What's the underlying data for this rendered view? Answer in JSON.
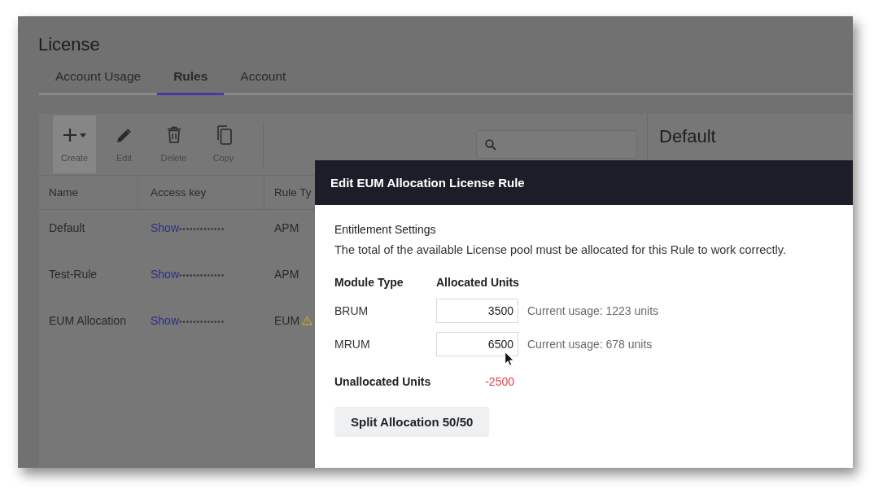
{
  "page": {
    "title": "License"
  },
  "tabs": [
    {
      "label": "Account Usage",
      "selected": false
    },
    {
      "label": "Rules",
      "selected": true
    },
    {
      "label": "Account",
      "selected": false
    }
  ],
  "toolbar": {
    "buttons": [
      {
        "label": "Create",
        "kind": "create",
        "highlighted": true
      },
      {
        "label": "Edit",
        "kind": "edit",
        "highlighted": false
      },
      {
        "label": "Delete",
        "kind": "delete",
        "highlighted": false
      },
      {
        "label": "Copy",
        "kind": "copy",
        "highlighted": false
      }
    ]
  },
  "table": {
    "columns": [
      "Name",
      "Access key",
      "Rule Ty"
    ],
    "rows": [
      {
        "name": "Default",
        "access_link": "Show",
        "access_mask": "•••••••••••••",
        "rule_type": "APM",
        "warning": false
      },
      {
        "name": "Test-Rule",
        "access_link": "Show",
        "access_mask": "•••••••••••••",
        "rule_type": "APM",
        "warning": false
      },
      {
        "name": "EUM Allocation",
        "access_link": "Show",
        "access_mask": "•••••••••••••",
        "rule_type": "EUM",
        "warning": true
      }
    ]
  },
  "detail_panel": {
    "title": "Default"
  },
  "dialog": {
    "title": "Edit EUM Allocation License Rule",
    "section_title": "Entitlement Settings",
    "description": "The total of the available License pool must be allocated for this Rule to work correctly.",
    "columns": [
      "Module Type",
      "Allocated Units"
    ],
    "modules": [
      {
        "name": "BRUM",
        "value": "3500",
        "usage": "Current usage: 1223 units"
      },
      {
        "name": "MRUM",
        "value": "6500",
        "usage": "Current usage: 678 units"
      }
    ],
    "unallocated": {
      "label": "Unallocated Units",
      "value": "-2500",
      "negative": true
    },
    "split_button": "Split Allocation 50/50"
  }
}
